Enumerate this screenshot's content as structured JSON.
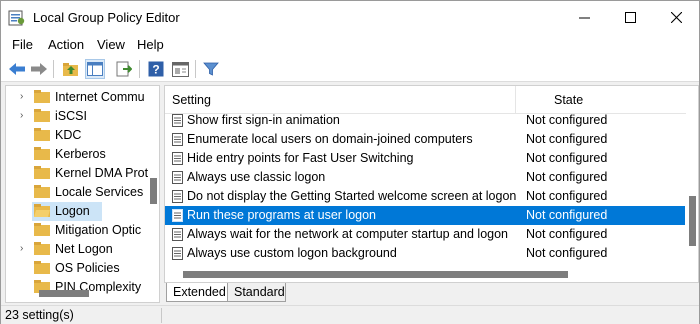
{
  "window": {
    "title": "Local Group Policy Editor"
  },
  "menu": [
    "File",
    "Action",
    "View",
    "Help"
  ],
  "toolbar": {
    "icons": [
      "back-arrow-icon",
      "forward-arrow-icon",
      "up-folder-icon",
      "show-hide-tree-icon",
      "export-list-icon",
      "help-icon",
      "properties-icon",
      "filter-icon"
    ]
  },
  "tree": {
    "items": [
      {
        "label": "Internet Commu",
        "expander": "›"
      },
      {
        "label": "iSCSI",
        "expander": "›"
      },
      {
        "label": "KDC",
        "expander": ""
      },
      {
        "label": "Kerberos",
        "expander": ""
      },
      {
        "label": "Kernel DMA Prot",
        "expander": ""
      },
      {
        "label": "Locale Services",
        "expander": ""
      },
      {
        "label": "Logon",
        "expander": "",
        "selected": true
      },
      {
        "label": "Mitigation Optic",
        "expander": ""
      },
      {
        "label": "Net Logon",
        "expander": "›"
      },
      {
        "label": "OS Policies",
        "expander": ""
      },
      {
        "label": "PIN Complexity",
        "expander": ""
      }
    ]
  },
  "settings": {
    "columns": {
      "setting": "Setting",
      "state": "State"
    },
    "rows": [
      {
        "name": "Show first sign-in animation",
        "state": "Not configured"
      },
      {
        "name": "Enumerate local users on domain-joined computers",
        "state": "Not configured"
      },
      {
        "name": "Hide entry points for Fast User Switching",
        "state": "Not configured"
      },
      {
        "name": "Always use classic logon",
        "state": "Not configured"
      },
      {
        "name": "Do not display the Getting Started welcome screen at logon",
        "state": "Not configured"
      },
      {
        "name": "Run these programs at user logon",
        "state": "Not configured",
        "selected": true
      },
      {
        "name": "Always wait for the network at computer startup and logon",
        "state": "Not configured"
      },
      {
        "name": "Always use custom logon background",
        "state": "Not configured"
      }
    ]
  },
  "tabs": [
    {
      "label": "Extended"
    },
    {
      "label": "Standard"
    }
  ],
  "status": {
    "text": "23 setting(s)"
  },
  "colors": {
    "selection": "#0078d7",
    "tree_selection": "#cce4f7",
    "folder": "#e8b94a"
  }
}
